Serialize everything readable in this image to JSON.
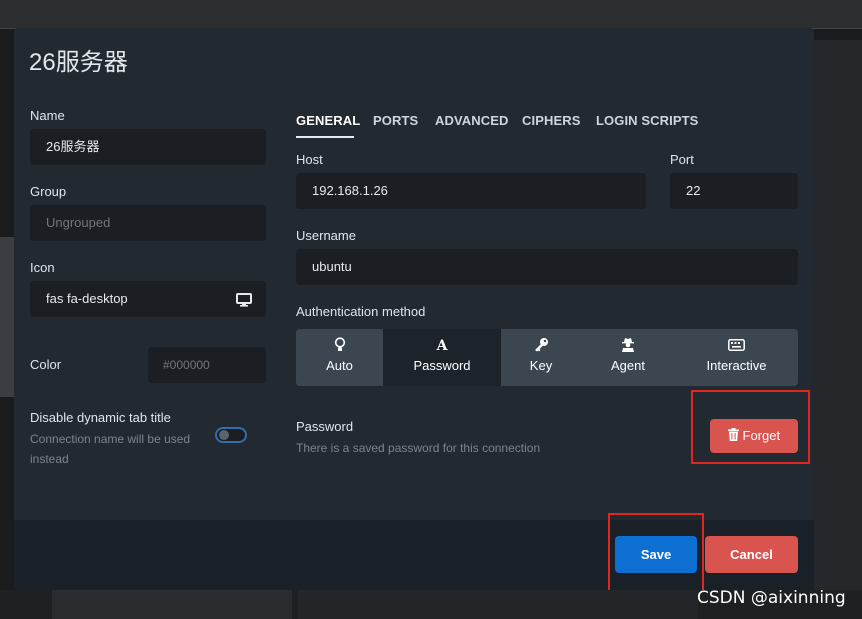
{
  "modal": {
    "title": "26服务器"
  },
  "left": {
    "name_label": "Name",
    "name_value": "26服务器",
    "group_label": "Group",
    "group_placeholder": "Ungrouped",
    "icon_label": "Icon",
    "icon_value": "fas fa-desktop",
    "icon_glyph": "desktop-icon",
    "color_label": "Color",
    "color_placeholder": "#000000",
    "tab_title_label": "Disable dynamic tab title",
    "tab_title_help_1": "Connection name will be used",
    "tab_title_help_2": "instead",
    "tab_title_enabled": false
  },
  "tabs": [
    {
      "label": "GENERAL",
      "active": true
    },
    {
      "label": "PORTS",
      "active": false
    },
    {
      "label": "ADVANCED",
      "active": false
    },
    {
      "label": "CIPHERS",
      "active": false
    },
    {
      "label": "LOGIN SCRIPTS",
      "active": false
    }
  ],
  "general": {
    "host_label": "Host",
    "host_value": "192.168.1.26",
    "port_label": "Port",
    "port_value": "22",
    "username_label": "Username",
    "username_value": "ubuntu",
    "auth_label": "Authentication method",
    "auth_methods": [
      {
        "label": "Auto",
        "icon": "lightbulb-icon",
        "active": false
      },
      {
        "label": "Password",
        "icon": "font-a-icon",
        "active": true
      },
      {
        "label": "Key",
        "icon": "key-icon",
        "active": false
      },
      {
        "label": "Agent",
        "icon": "user-secret-icon",
        "active": false
      },
      {
        "label": "Interactive",
        "icon": "keyboard-icon",
        "active": false
      }
    ],
    "password_label": "Password",
    "password_note": "There is a saved password for this connection",
    "forget_label": "Forget"
  },
  "footer": {
    "save_label": "Save",
    "cancel_label": "Cancel"
  },
  "watermark": "CSDN @aixinning",
  "colors": {
    "modal_bg": "#222930",
    "input_bg": "#1b1f24",
    "primary": "#0d6fd1",
    "danger": "#d9534f",
    "highlight_box": "#e0261f"
  }
}
